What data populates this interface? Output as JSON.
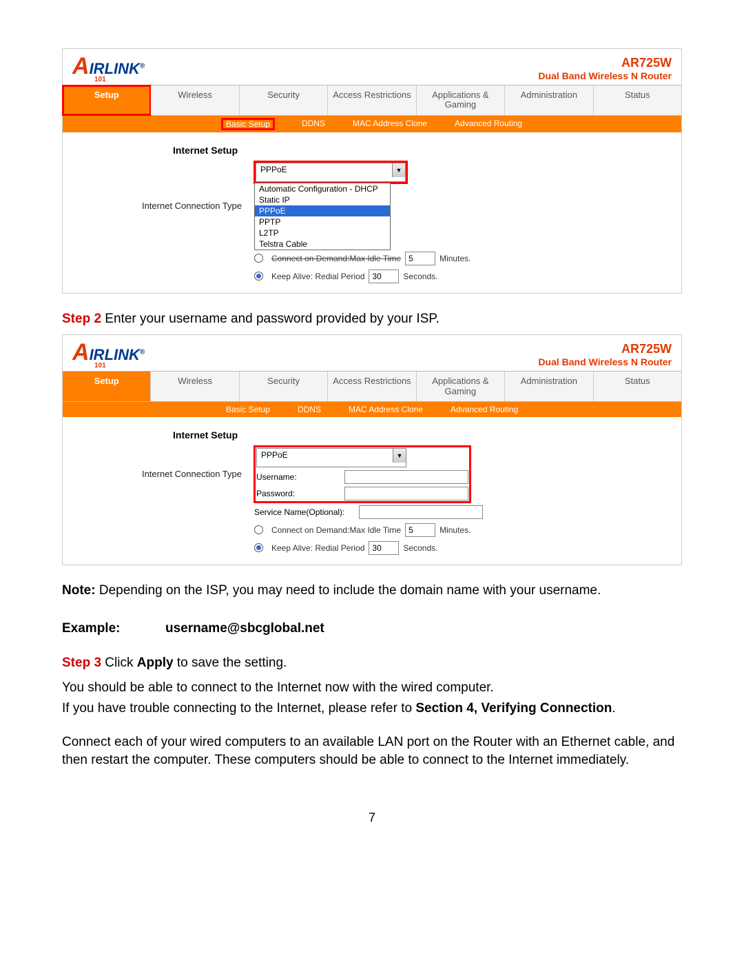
{
  "router": {
    "brand_main": "IRLINK",
    "brand_sub": "101",
    "model": "AR725W",
    "model_sub": "Dual Band Wireless N Router",
    "tabs": [
      "Setup",
      "Wireless",
      "Security",
      "Access Restrictions",
      "Applications & Gaming",
      "Administration",
      "Status"
    ],
    "subtabs": [
      "Basic Setup",
      "DDNS",
      "MAC Address Clone",
      "Advanced Routing"
    ],
    "section_title": "Internet Setup",
    "conn_type_label": "Internet Connection Type",
    "sel_value": "PPPoE",
    "options": [
      "Automatic Configuration - DHCP",
      "Static IP",
      "PPPoE",
      "PPTP",
      "L2TP",
      "Telstra Cable"
    ],
    "username_label": "Username:",
    "password_label": "Password:",
    "service_label": "Service Name(Optional):",
    "cod_label": "Connect on Demand:Max Idle Time",
    "cod_val": "5",
    "cod_unit": "Minutes.",
    "ka_label": "Keep Alive: Redial Period",
    "ka_val": "30",
    "ka_unit": "Seconds."
  },
  "doc": {
    "step2_lead": "Step 2",
    "step2_text": " Enter your username and password provided by your ISP.",
    "note_lead": "Note:",
    "note_text": " Depending on the ISP, you may need to include the domain name with your username.",
    "example_key": "Example:",
    "example_val": "username@sbcglobal.net",
    "step3_lead": "Step 3",
    "step3_a": " Click ",
    "step3_b": "Apply",
    "step3_c": " to save the setting.",
    "p1": "You should be able to connect to the Internet now with the wired computer.",
    "p2a": "If you have trouble connecting to the Internet, please refer to ",
    "p2b": "Section 4, Verifying Connection",
    "p2c": ".",
    "p3": "Connect each of your wired computers to an available LAN port on the Router with an Ethernet cable, and then restart the computer. These computers should be able to connect to the Internet immediately.",
    "pagenum": "7"
  }
}
